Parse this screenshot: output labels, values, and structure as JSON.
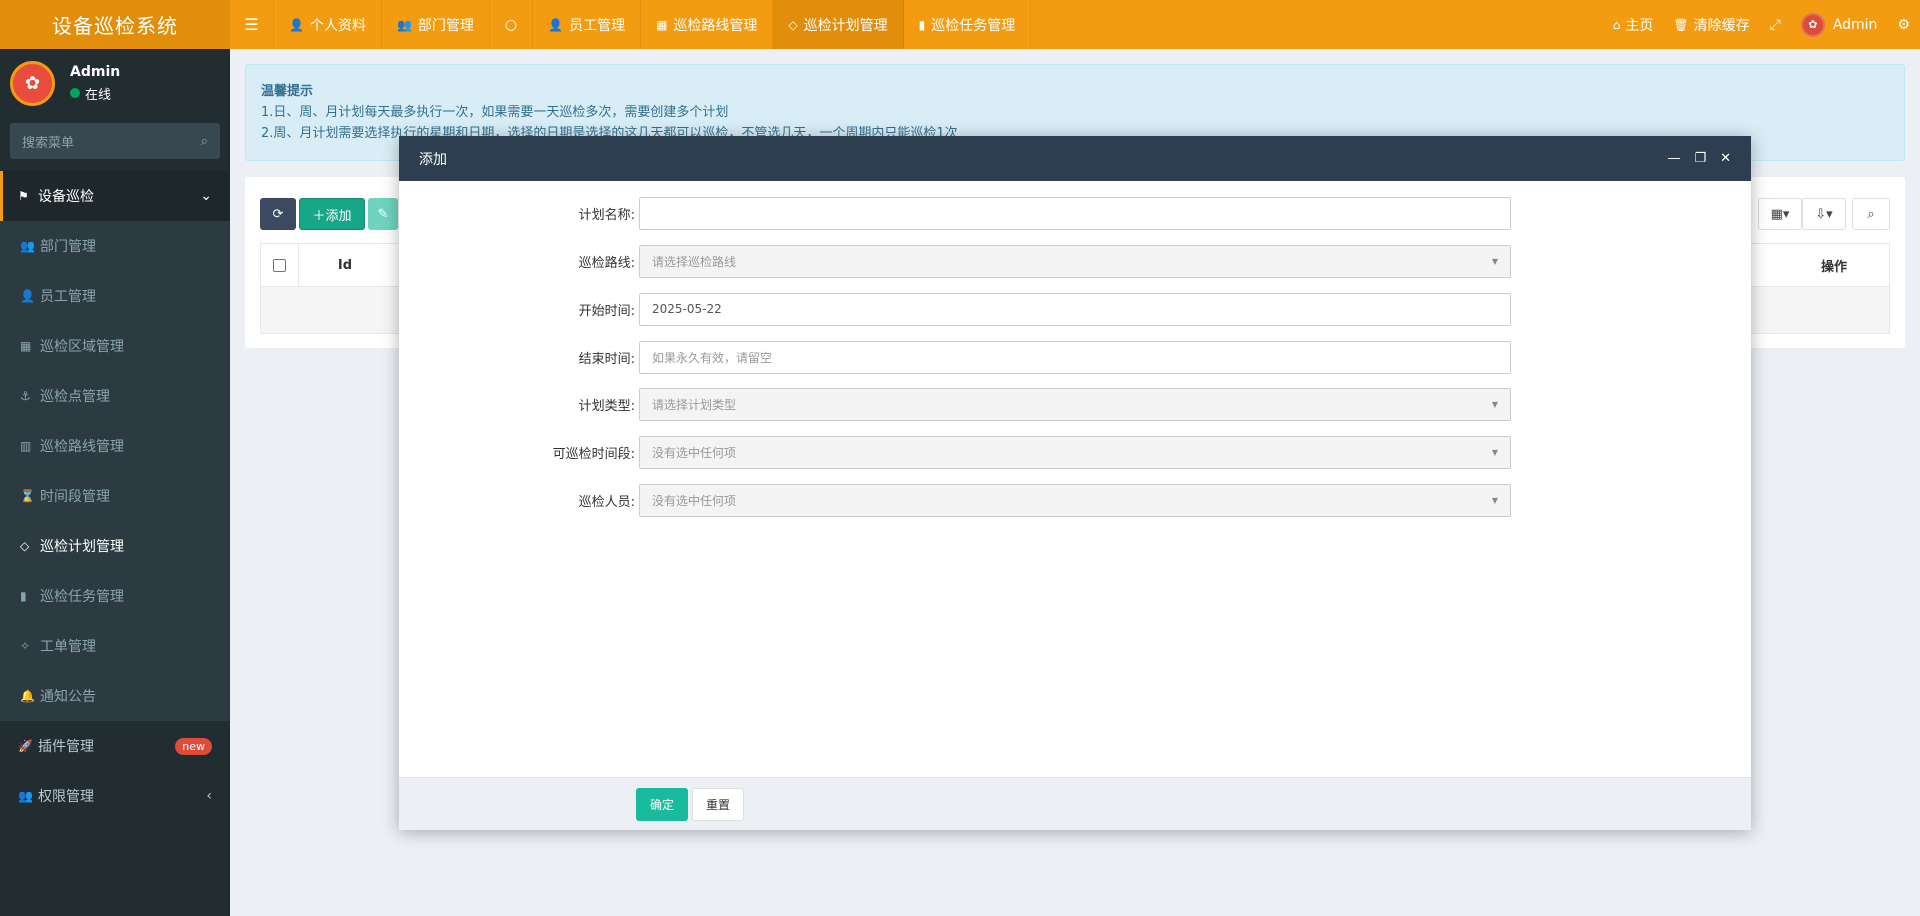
{
  "header": {
    "logo": "设备巡检系统",
    "nav": [
      {
        "label": "个人资料",
        "icon": "user-icon"
      },
      {
        "label": "部门管理",
        "icon": "users-icon"
      },
      {
        "label": "",
        "icon": "circle-icon"
      },
      {
        "label": "员工管理",
        "icon": "user-icon"
      },
      {
        "label": "巡检路线管理",
        "icon": "map-icon"
      },
      {
        "label": "巡检计划管理",
        "icon": "code-icon"
      },
      {
        "label": "巡检任务管理",
        "icon": "bookmark-icon"
      }
    ],
    "right": {
      "home": "主页",
      "clear_cache": "清除缓存",
      "user": "Admin"
    }
  },
  "sidebar": {
    "user": {
      "name": "Admin",
      "status": "在线"
    },
    "search_placeholder": "搜索菜单",
    "section": "设备巡检",
    "items": [
      {
        "label": "部门管理"
      },
      {
        "label": "员工管理"
      },
      {
        "label": "巡检区域管理"
      },
      {
        "label": "巡检点管理"
      },
      {
        "label": "巡检路线管理"
      },
      {
        "label": "时间段管理"
      },
      {
        "label": "巡检计划管理"
      },
      {
        "label": "巡检任务管理"
      },
      {
        "label": "工单管理"
      },
      {
        "label": "通知公告"
      }
    ],
    "plugin": {
      "label": "插件管理",
      "badge": "new"
    },
    "permission": {
      "label": "权限管理"
    }
  },
  "alert": {
    "title": "温馨提示",
    "line1": "1.日、周、月计划每天最多执行一次，如果需要一天巡检多次，需要创建多个计划",
    "line2": "2.周、月计划需要选择执行的星期和日期，选择的日期是选择的这几天都可以巡检，不管选几天，一个周期内只能巡检1次"
  },
  "toolbar": {
    "add": "添加"
  },
  "table": {
    "col_id": "Id",
    "col_op": "操作"
  },
  "modal": {
    "title": "添加",
    "fields": {
      "plan_name": {
        "label": "计划名称:",
        "value": ""
      },
      "route": {
        "label": "巡检路线:",
        "placeholder": "请选择巡检路线"
      },
      "start": {
        "label": "开始时间:",
        "value": "2025-05-22"
      },
      "end": {
        "label": "结束时间:",
        "placeholder": "如果永久有效，请留空"
      },
      "type": {
        "label": "计划类型:",
        "placeholder": "请选择计划类型"
      },
      "timeslot": {
        "label": "可巡检时间段:",
        "placeholder": "没有选中任何项"
      },
      "staff": {
        "label": "巡检人员:",
        "placeholder": "没有选中任何项"
      }
    },
    "confirm": "确定",
    "reset": "重置"
  }
}
